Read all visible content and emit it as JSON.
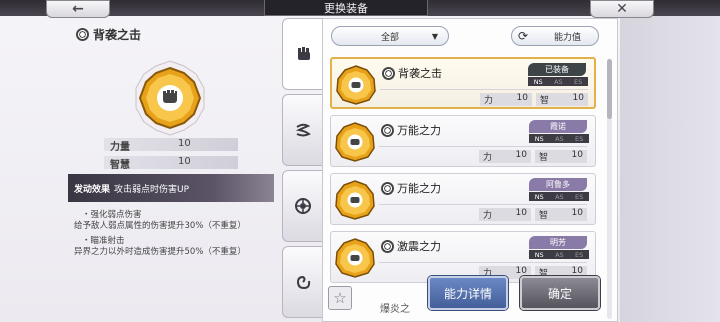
{
  "header": {
    "title": "更换装备",
    "back_icon": "←",
    "close_icon": "✕"
  },
  "selected": {
    "name": "背袭之击",
    "stats": [
      {
        "label": "力量",
        "value": "10"
      },
      {
        "label": "智慧",
        "value": "10"
      }
    ],
    "effect_title": "发动效果",
    "effect_summary": "攻击弱点时伤害UP",
    "effects": [
      {
        "title": "・强化弱点伤害",
        "text": "给予敌人弱点属性的伤害提升30%（不重复）"
      },
      {
        "title": "・瞄准射击",
        "text": "异界之力以外时造成伤害提升50%（不重复）"
      }
    ]
  },
  "filter": {
    "label": "全部",
    "arrow": "▼"
  },
  "sort": {
    "label": "能力值",
    "icon": "⟳"
  },
  "colors": {
    "selected_border": "#e2b24a",
    "equipped_badge": "#3e4548",
    "char_badge": "#8a7aa8",
    "detail_button": "#5573b0"
  },
  "cards": [
    {
      "name": "背袭之击",
      "badge": "已装备",
      "tags": [
        "NS",
        "AS",
        "ES"
      ],
      "stat1_label": "力",
      "stat1_value": "10",
      "stat2_label": "智",
      "stat2_value": "10"
    },
    {
      "name": "万能之力",
      "badge": "霞诺",
      "tags": [
        "NS",
        "AS",
        "ES"
      ],
      "stat1_label": "力",
      "stat1_value": "10",
      "stat2_label": "智",
      "stat2_value": "10"
    },
    {
      "name": "万能之力",
      "badge": "阿鲁多",
      "tags": [
        "NS",
        "AS",
        "ES"
      ],
      "stat1_label": "力",
      "stat1_value": "10",
      "stat2_label": "智",
      "stat2_value": "10"
    },
    {
      "name": "激震之力",
      "badge": "明芳",
      "tags": [
        "NS",
        "AS",
        "ES"
      ],
      "stat1_label": "力",
      "stat1_value": "10",
      "stat2_label": "智",
      "stat2_value": "10"
    }
  ],
  "partial_card_name": "爆炎之",
  "buttons": {
    "detail": "能力详情",
    "confirm": "确定",
    "favorite_icon": "☆"
  },
  "tab_icons": [
    "fist-icon",
    "wind-icon",
    "burst-icon",
    "swirl-icon"
  ]
}
